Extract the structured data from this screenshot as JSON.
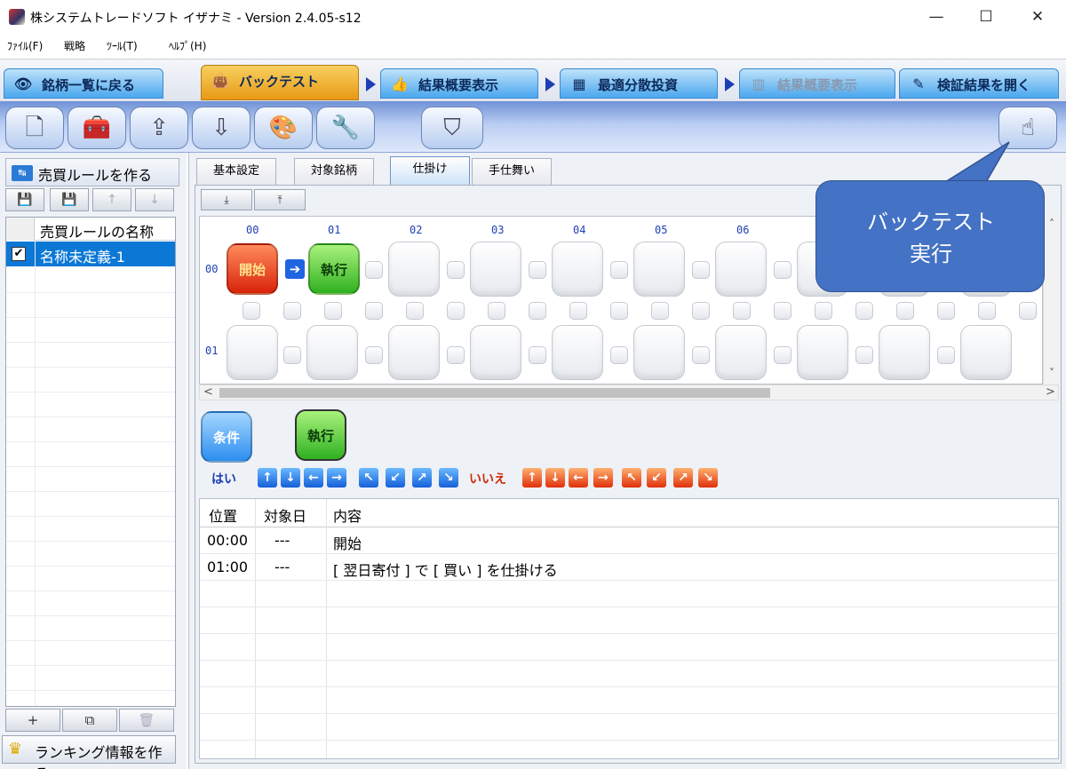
{
  "window": {
    "title": "株システムトレードソフト イザナミ - Version 2.4.05-s12",
    "minimize": "—",
    "maximize": "☐",
    "close": "✕"
  },
  "menu": [
    "ﾌｧｲﾙ(F)",
    "戦略",
    "ﾂｰﾙ(T)",
    "ﾍﾙﾌﾟ(H)"
  ],
  "main_tabs": [
    {
      "label": "銘柄一覧に戻る",
      "icon": "eye-icon",
      "glyph": "👁"
    },
    {
      "label": "バックテスト",
      "icon": "bag-icon",
      "glyph": "👜"
    },
    {
      "label": "結果概要表示",
      "icon": "thumbs-up-icon",
      "glyph": "👍"
    },
    {
      "label": "最適分散投資",
      "icon": "calculator-icon",
      "glyph": "▦"
    },
    {
      "label": "結果概要表示",
      "icon": "bar-chart-icon",
      "glyph": "▥"
    },
    {
      "label": "検証結果を開く",
      "icon": "stamp-icon",
      "glyph": "✎"
    }
  ],
  "toolbar": {
    "buttons": [
      {
        "icon": "new-file-icon",
        "glyph": "🗋"
      },
      {
        "icon": "toolbox-icon",
        "glyph": "🧰"
      },
      {
        "icon": "export-icon",
        "glyph": "⇪"
      },
      {
        "icon": "import-icon",
        "glyph": "⇩"
      },
      {
        "icon": "palette-icon",
        "glyph": "🎨"
      },
      {
        "icon": "tools-icon",
        "glyph": "🔧"
      },
      {
        "icon": "beginner-mark-icon",
        "glyph": "⛉"
      },
      {
        "icon": "run-backtest-icon",
        "glyph": "☝"
      }
    ]
  },
  "left_panel": {
    "title": "売買ルールを作る",
    "title_icon_text": "↹",
    "mini_tools": [
      "💾",
      "💾",
      "↑",
      "↓"
    ],
    "list_header": "売買ルールの名称",
    "rules": [
      {
        "name": "名称未定義-1",
        "checked": "✔"
      }
    ],
    "bottom_tools": [
      "+",
      "⧉",
      "🗑"
    ],
    "ranking_label": "ランキング情報を作る",
    "ranking_glyph": "♛"
  },
  "sub_tabs": [
    "基本設定",
    "対象銘柄",
    "仕掛け",
    "手仕舞い"
  ],
  "grid_tools": [
    "⤓",
    "⤒"
  ],
  "grid": {
    "col_labels": [
      "00",
      "01",
      "02",
      "03",
      "04",
      "05",
      "06"
    ],
    "row_labels": [
      "00",
      "01"
    ],
    "start_block": "開始",
    "exec_block": "執行",
    "arrow": "➔"
  },
  "scroll": {
    "up": "˄",
    "down": "˅",
    "left": "<",
    "right": ">"
  },
  "palette": {
    "cond": "条件",
    "exec": "執行",
    "yes_label": "はい",
    "no_label": "いいえ",
    "yes_dirs": [
      "↑",
      "↓",
      "←",
      "→",
      "↖",
      "↙",
      "↗",
      "↘"
    ],
    "no_dirs": [
      "↑",
      "↓",
      "←",
      "→",
      "↖",
      "↙",
      "↗",
      "↘"
    ]
  },
  "log": {
    "headers": [
      "位置",
      "対象日",
      "内容"
    ],
    "rows": [
      {
        "pos": "00:00",
        "date": "---",
        "content": "開始"
      },
      {
        "pos": "01:00",
        "date": "---",
        "content": "[ 翌日寄付 ] で [ 買い ] を仕掛ける"
      }
    ]
  },
  "callout": {
    "line1": "バックテスト",
    "line2": "実行"
  }
}
